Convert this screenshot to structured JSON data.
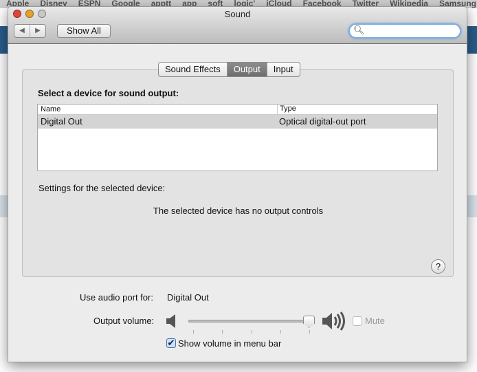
{
  "background": {
    "bookmarks": [
      "Apple",
      "Disney",
      "ESPN",
      "Google",
      "apptt",
      "app",
      "soft",
      "logic'",
      "iCloud",
      "Facebook",
      "Twitter",
      "Wikipedia",
      "Samsung U"
    ]
  },
  "window": {
    "title": "Sound",
    "toolbar": {
      "back_icon": "chevron-left-icon",
      "forward_icon": "chevron-right-icon",
      "show_all_label": "Show All",
      "search_placeholder": ""
    },
    "tabs": [
      {
        "label": "Sound Effects",
        "selected": false
      },
      {
        "label": "Output",
        "selected": true
      },
      {
        "label": "Input",
        "selected": false
      }
    ],
    "output": {
      "heading": "Select a device for sound output:",
      "table": {
        "columns": [
          "Name",
          "Type"
        ],
        "rows": [
          {
            "name": "Digital Out",
            "type": "Optical digital-out port",
            "selected": true
          }
        ]
      },
      "settings_label": "Settings for the selected device:",
      "no_controls": "The selected device has no output controls",
      "help": "?"
    },
    "audio_port_label": "Use audio port for:",
    "audio_port_value": "Digital Out",
    "volume_label": "Output volume:",
    "volume_level": 1.0,
    "mute_label": "Mute",
    "mute_checked": false,
    "mute_enabled": false,
    "show_volume_label": "Show volume in menu bar",
    "show_volume_checked": true,
    "colors": {
      "accent": "#5b9ae0",
      "close": "#e0443e",
      "minimize": "#e8a22a"
    }
  }
}
